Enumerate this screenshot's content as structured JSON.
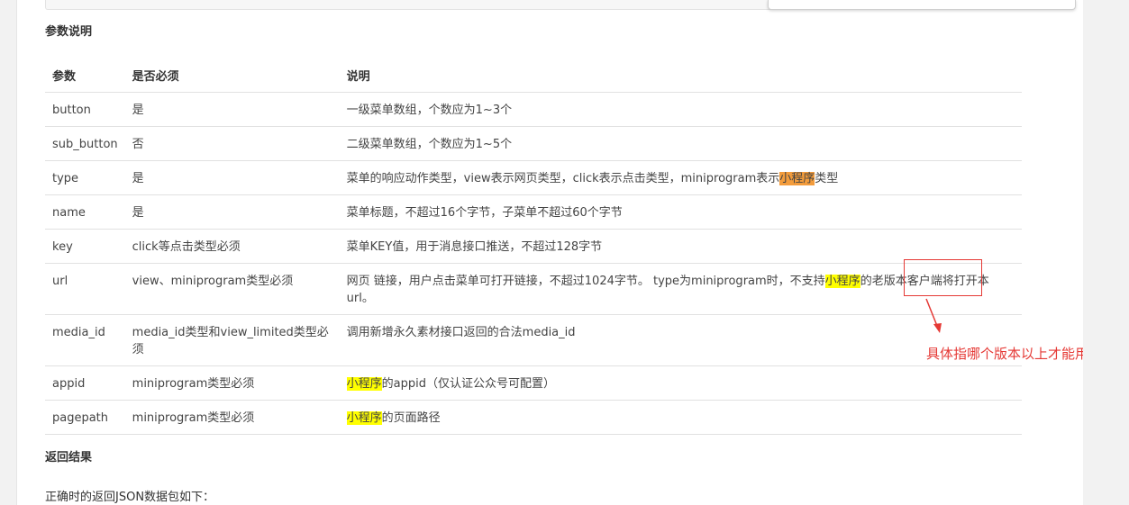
{
  "sections": {
    "params_title": "参数说明",
    "return_title": "返回结果",
    "return_text": "正确时的返回JSON数据包如下："
  },
  "table": {
    "headers": [
      "参数",
      "是否必须",
      "说明"
    ],
    "rows": [
      {
        "param": "button",
        "required": "是",
        "desc": "一级菜单数组，个数应为1~3个"
      },
      {
        "param": "sub_button",
        "required": "否",
        "desc": "二级菜单数组，个数应为1~5个"
      },
      {
        "param": "type",
        "required": "是",
        "desc_pre": "菜单的响应动作类型，view表示网页类型，click表示点击类型，miniprogram表示",
        "desc_hl": "小程序",
        "desc_post": "类型"
      },
      {
        "param": "name",
        "required": "是",
        "desc": "菜单标题，不超过16个字节，子菜单不超过60个字节"
      },
      {
        "param": "key",
        "required": "click等点击类型必须",
        "desc": "菜单KEY值，用于消息接口推送，不超过128字节"
      },
      {
        "param": "url",
        "required": "view、miniprogram类型必须",
        "desc_pre": "网页 链接，用户点击菜单可打开链接，不超过1024字节。 type为miniprogram时，不支持",
        "desc_hl": "小程序",
        "desc_post": "的老版本客户端将打开本url。"
      },
      {
        "param": "media_id",
        "required": "media_id类型和view_limited类型必须",
        "desc": "调用新增永久素材接口返回的合法media_id"
      },
      {
        "param": "appid",
        "required": "miniprogram类型必须",
        "desc_hl": "小程序",
        "desc_post": "的appid（仅认证公众号可配置）"
      },
      {
        "param": "pagepath",
        "required": "miniprogram类型必须",
        "desc_hl": "小程序",
        "desc_post": "的页面路径"
      }
    ]
  },
  "annotation": {
    "text": "具体指哪个版本以上才能用",
    "color": "#e53935"
  },
  "colors": {
    "highlight_yellow": "#ffff00",
    "highlight_orange": "#f39c3c"
  }
}
